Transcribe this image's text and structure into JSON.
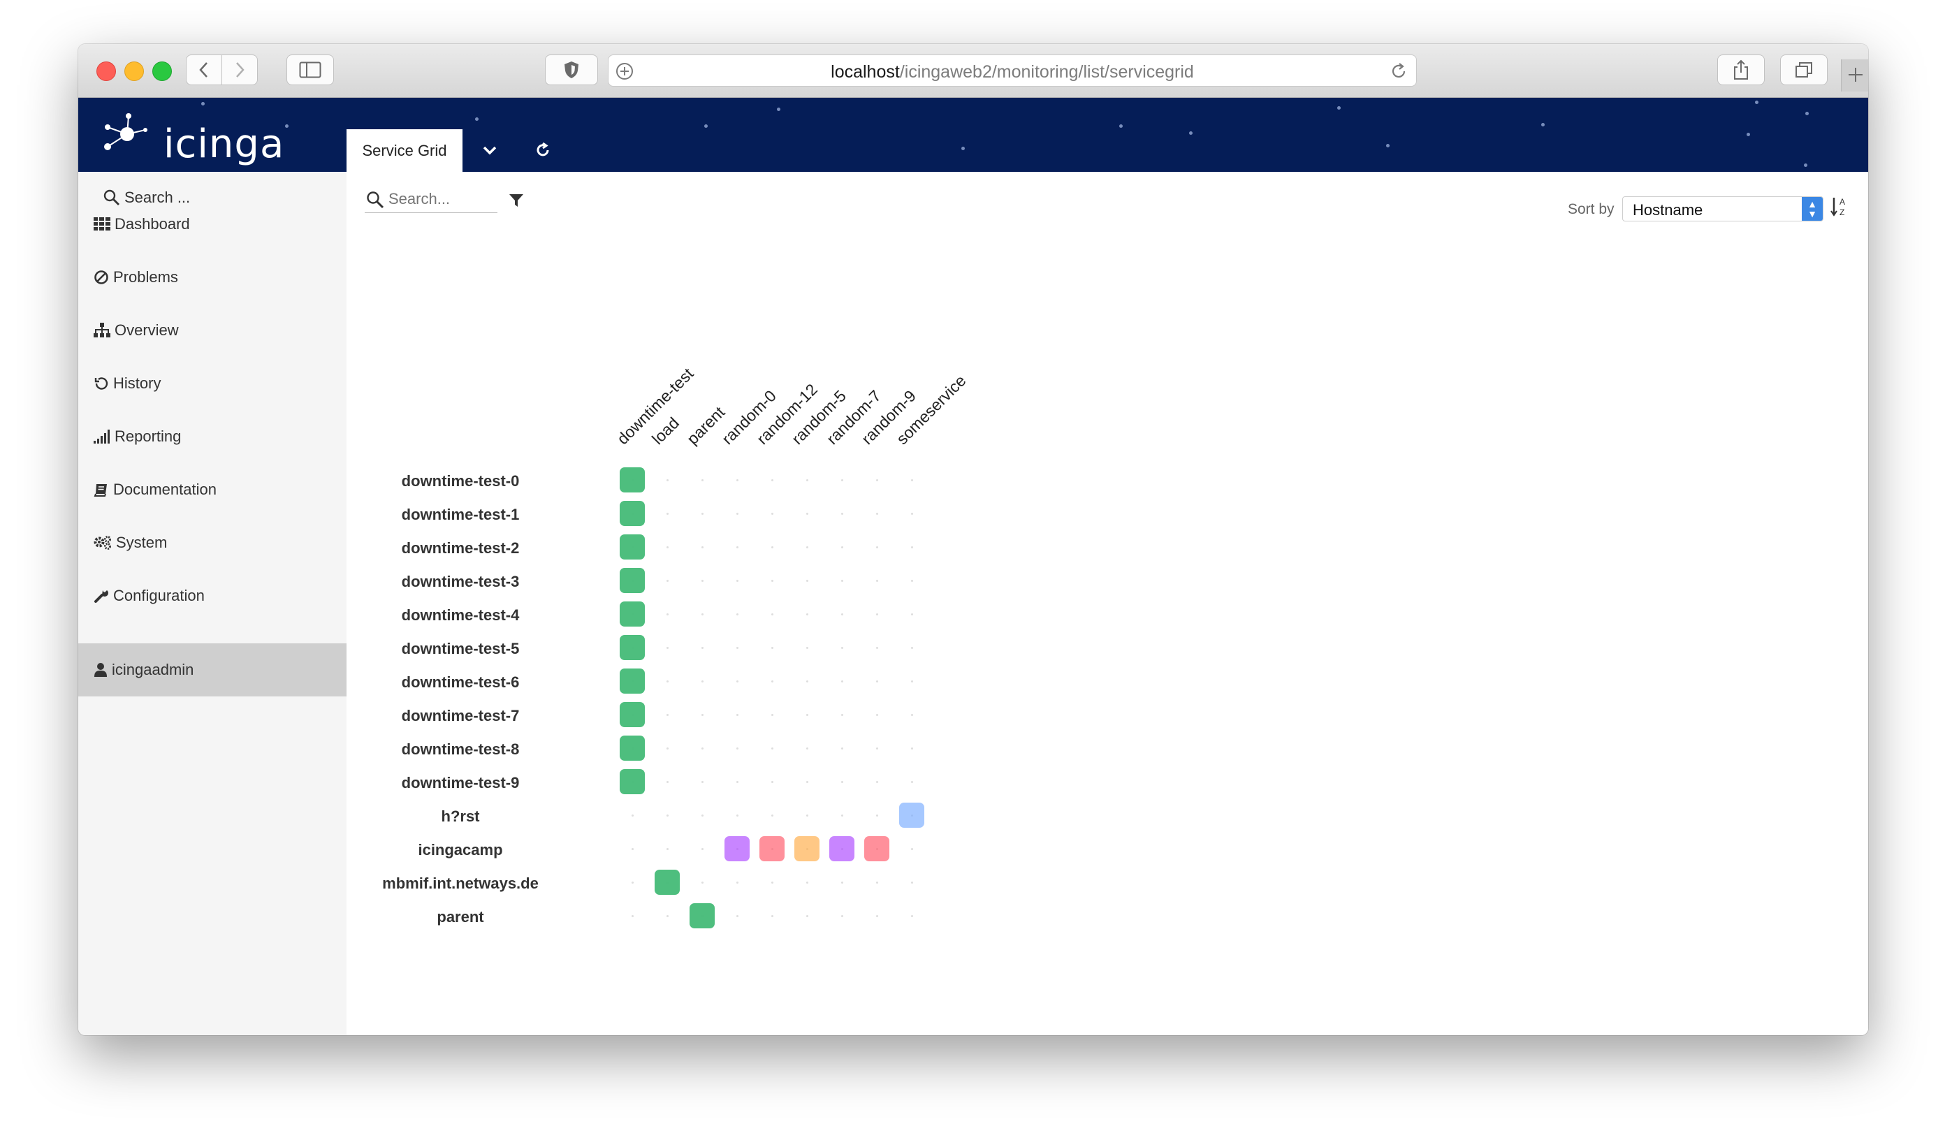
{
  "browser": {
    "url_host": "localhost",
    "url_path": "/icingaweb2/monitoring/list/servicegrid"
  },
  "app": {
    "logo_text": "icinga",
    "active_tab": "Service Grid"
  },
  "sidebar": {
    "search_placeholder": "Search ...",
    "items": [
      {
        "label": "Dashboard",
        "icon": "dashboard-icon"
      },
      {
        "label": "Problems",
        "icon": "problems-icon"
      },
      {
        "label": "Overview",
        "icon": "overview-icon"
      },
      {
        "label": "History",
        "icon": "history-icon"
      },
      {
        "label": "Reporting",
        "icon": "reporting-icon"
      },
      {
        "label": "Documentation",
        "icon": "book-icon"
      },
      {
        "label": "System",
        "icon": "gear-icon"
      },
      {
        "label": "Configuration",
        "icon": "wrench-icon"
      },
      {
        "label": "icingaadmin",
        "icon": "user-icon"
      }
    ]
  },
  "filter": {
    "search_placeholder": "Search..."
  },
  "sort": {
    "label": "Sort by",
    "selected": "Hostname"
  },
  "grid": {
    "services": [
      "downtime-test",
      "load",
      "parent",
      "random-0",
      "random-12",
      "random-5",
      "random-7",
      "random-9",
      "someservice"
    ],
    "hosts": [
      "downtime-test-0",
      "downtime-test-1",
      "downtime-test-2",
      "downtime-test-3",
      "downtime-test-4",
      "downtime-test-5",
      "downtime-test-6",
      "downtime-test-7",
      "downtime-test-8",
      "downtime-test-9",
      "h?rst",
      "icingacamp",
      "mbmif.int.netways.de",
      "parent"
    ],
    "status_colors": {
      "ok": "#44bb77",
      "pending": "#77aaff",
      "unknown": "#aa44ff",
      "critical": "#ff5566",
      "warning": "#ffaa44"
    },
    "cells": [
      {
        "host": "downtime-test-0",
        "service": "downtime-test",
        "state": "ok"
      },
      {
        "host": "downtime-test-1",
        "service": "downtime-test",
        "state": "ok"
      },
      {
        "host": "downtime-test-2",
        "service": "downtime-test",
        "state": "ok"
      },
      {
        "host": "downtime-test-3",
        "service": "downtime-test",
        "state": "ok"
      },
      {
        "host": "downtime-test-4",
        "service": "downtime-test",
        "state": "ok"
      },
      {
        "host": "downtime-test-5",
        "service": "downtime-test",
        "state": "ok"
      },
      {
        "host": "downtime-test-6",
        "service": "downtime-test",
        "state": "ok"
      },
      {
        "host": "downtime-test-7",
        "service": "downtime-test",
        "state": "ok"
      },
      {
        "host": "downtime-test-8",
        "service": "downtime-test",
        "state": "ok"
      },
      {
        "host": "downtime-test-9",
        "service": "downtime-test",
        "state": "ok"
      },
      {
        "host": "h?rst",
        "service": "someservice",
        "state": "pending"
      },
      {
        "host": "icingacamp",
        "service": "random-0",
        "state": "unknown"
      },
      {
        "host": "icingacamp",
        "service": "random-12",
        "state": "critical"
      },
      {
        "host": "icingacamp",
        "service": "random-5",
        "state": "warning"
      },
      {
        "host": "icingacamp",
        "service": "random-7",
        "state": "unknown"
      },
      {
        "host": "icingacamp",
        "service": "random-9",
        "state": "critical"
      },
      {
        "host": "mbmif.int.netways.de",
        "service": "load",
        "state": "ok"
      },
      {
        "host": "parent",
        "service": "parent",
        "state": "ok"
      }
    ]
  }
}
